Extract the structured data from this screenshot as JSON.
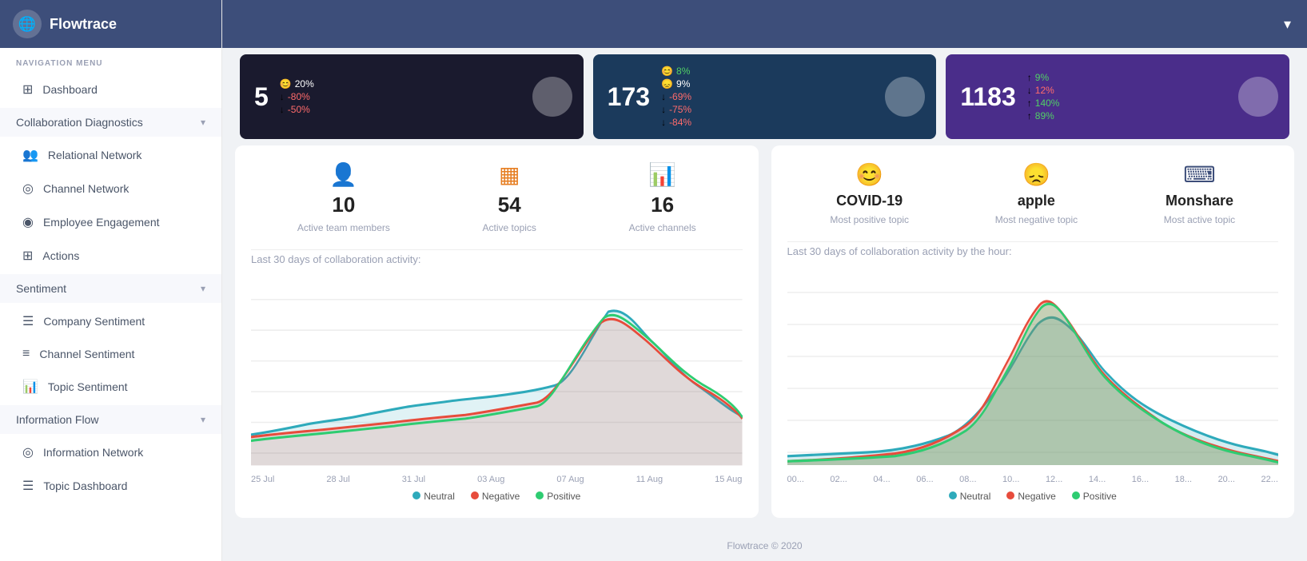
{
  "sidebar": {
    "logo_char": "🌐",
    "title": "Flowtrace",
    "nav_label": "NAVIGATION MENU",
    "items": [
      {
        "id": "dashboard",
        "label": "Dashboard",
        "icon": "⊞",
        "type": "item"
      },
      {
        "id": "collab",
        "label": "Collaboration Diagnostics",
        "icon": "",
        "type": "group",
        "chevron": "▾"
      },
      {
        "id": "relational",
        "label": "Relational Network",
        "icon": "👥",
        "type": "subitem"
      },
      {
        "id": "channel",
        "label": "Channel Network",
        "icon": "◎",
        "type": "subitem"
      },
      {
        "id": "employee",
        "label": "Employee Engagement",
        "icon": "◉",
        "type": "subitem"
      },
      {
        "id": "actions",
        "label": "Actions",
        "icon": "⊞",
        "type": "subitem"
      },
      {
        "id": "sentiment",
        "label": "Sentiment",
        "icon": "",
        "type": "group",
        "chevron": "▾"
      },
      {
        "id": "company-sentiment",
        "label": "Company Sentiment",
        "icon": "☰",
        "type": "subitem"
      },
      {
        "id": "channel-sentiment",
        "label": "Channel Sentiment",
        "icon": "≡",
        "type": "subitem"
      },
      {
        "id": "topic-sentiment",
        "label": "Topic Sentiment",
        "icon": "📊",
        "type": "subitem"
      },
      {
        "id": "info-flow",
        "label": "Information Flow",
        "icon": "",
        "type": "group",
        "chevron": "▾"
      },
      {
        "id": "info-network",
        "label": "Information Network",
        "icon": "◎",
        "type": "subitem"
      },
      {
        "id": "topic-dashboard",
        "label": "Topic Dashboard",
        "icon": "☰",
        "type": "subitem"
      }
    ]
  },
  "topbar": {
    "chevron": "▾"
  },
  "stats_top": [
    {
      "id": "card1",
      "theme": "dark1",
      "number": "5",
      "metrics": [
        {
          "icon": "😊",
          "val": "20%",
          "dir": "neutral"
        },
        {
          "icon": "😞",
          "val": "-80%",
          "dir": "down"
        },
        {
          "icon": "😞",
          "val": "-50%",
          "dir": "down"
        }
      ]
    },
    {
      "id": "card2",
      "theme": "dark2",
      "number": "173",
      "metrics": [
        {
          "icon": "😊",
          "val": "8%",
          "dir": "up"
        },
        {
          "icon": "😞",
          "val": "-69%",
          "dir": "down"
        },
        {
          "icon": "😞",
          "val": "-75%",
          "dir": "down"
        },
        {
          "icon": "😞",
          "val": "-84%",
          "dir": "down"
        }
      ]
    },
    {
      "id": "card3",
      "theme": "dark3",
      "number": "1183",
      "metrics": [
        {
          "icon": "😊",
          "val": "9%",
          "dir": "up"
        },
        {
          "icon": "😊",
          "val": "12%",
          "dir": "down"
        },
        {
          "icon": "😊",
          "val": "140%",
          "dir": "up"
        },
        {
          "icon": "😊",
          "val": "89%",
          "dir": "up"
        }
      ]
    }
  ],
  "left_panel": {
    "stats": [
      {
        "icon": "👤",
        "icon_color": "#2ecc71",
        "num": "10",
        "label": "Active team members"
      },
      {
        "icon": "▦",
        "icon_color": "#e67e22",
        "num": "54",
        "label": "Active topics"
      },
      {
        "icon": "📊",
        "icon_color": "#3498db",
        "num": "16",
        "label": "Active channels"
      }
    ],
    "subtitle": "Last 30 days of collaboration activity:",
    "x_labels": [
      "25 Jul",
      "28 Jul",
      "31 Jul",
      "03 Aug",
      "07 Aug",
      "11 Aug",
      "15 Aug"
    ],
    "legend": [
      {
        "color": "#2eaabb",
        "label": "Neutral"
      },
      {
        "color": "#e74c3c",
        "label": "Negative"
      },
      {
        "color": "#2ecc71",
        "label": "Positive"
      }
    ]
  },
  "right_panel": {
    "topics": [
      {
        "icon": "😊",
        "icon_color": "#2ecc71",
        "name": "COVID-19",
        "desc": "Most positive topic"
      },
      {
        "icon": "😞",
        "icon_color": "#e74c3c",
        "name": "apple",
        "desc": "Most negative topic"
      },
      {
        "icon": "⌨",
        "icon_color": "#3d4e7a",
        "name": "Monshare",
        "desc": "Most active topic"
      }
    ],
    "subtitle": "Last 30 days of collaboration activity by the hour:",
    "x_labels": [
      "00...",
      "02...",
      "04...",
      "06...",
      "08...",
      "10...",
      "12...",
      "14...",
      "16...",
      "18...",
      "20...",
      "22..."
    ],
    "legend": [
      {
        "color": "#2eaabb",
        "label": "Neutral"
      },
      {
        "color": "#e74c3c",
        "label": "Negative"
      },
      {
        "color": "#2ecc71",
        "label": "Positive"
      }
    ]
  },
  "footer": {
    "text": "Flowtrace © 2020"
  }
}
